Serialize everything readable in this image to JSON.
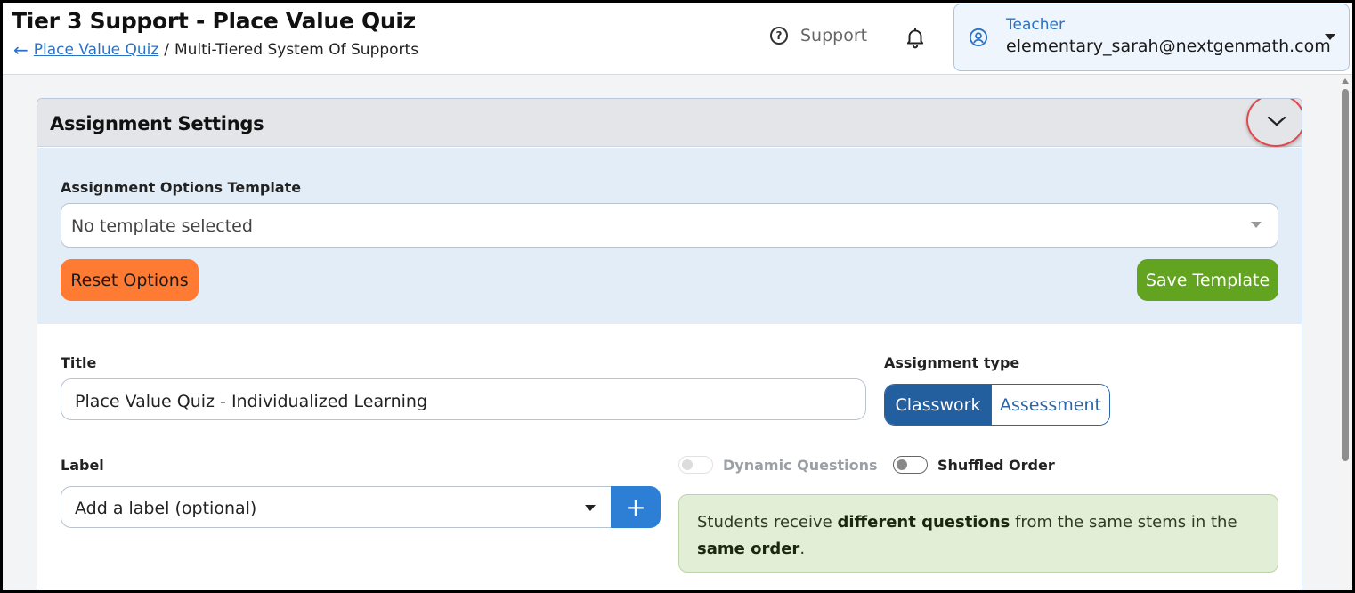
{
  "header": {
    "title": "Tier 3 Support - Place Value Quiz",
    "breadcrumb": {
      "back_icon": "arrow-left-icon",
      "link": "Place Value Quiz",
      "separator": "/",
      "current": "Multi-Tiered System Of Supports"
    },
    "support_label": "Support",
    "support_icon": "question-circle-icon",
    "bell_icon": "bell-icon",
    "user": {
      "role": "Teacher",
      "email": "elementary_sarah@nextgenmath.com",
      "icon": "user-circle-icon"
    }
  },
  "panel": {
    "title": "Assignment Settings",
    "collapse_icon": "chevron-down-icon",
    "template": {
      "label": "Assignment Options Template",
      "value": "No template selected",
      "reset_label": "Reset Options",
      "save_label": "Save Template"
    },
    "title_field": {
      "label": "Title",
      "value": "Place Value Quiz - Individualized Learning"
    },
    "assignment_type": {
      "label": "Assignment type",
      "options": [
        "Classwork",
        "Assessment"
      ],
      "selected": "Classwork"
    },
    "label_field": {
      "label": "Label",
      "placeholder": "Add a label (optional)",
      "add_icon": "plus-icon"
    },
    "toggles": {
      "dynamic_questions": {
        "label": "Dynamic Questions",
        "on": false,
        "disabled": true
      },
      "shuffled_order": {
        "label": "Shuffled Order",
        "on": false,
        "disabled": false
      }
    },
    "info": {
      "part1": "Students receive ",
      "bold1": "different questions",
      "part2": " from the same stems in the ",
      "bold2": "same order",
      "part3": "."
    }
  },
  "colors": {
    "accent_blue": "#2b72c4",
    "reset_orange": "#ff7a33",
    "save_green": "#62a320",
    "segment_active": "#235e9f",
    "highlight_ring": "#e0494b"
  }
}
